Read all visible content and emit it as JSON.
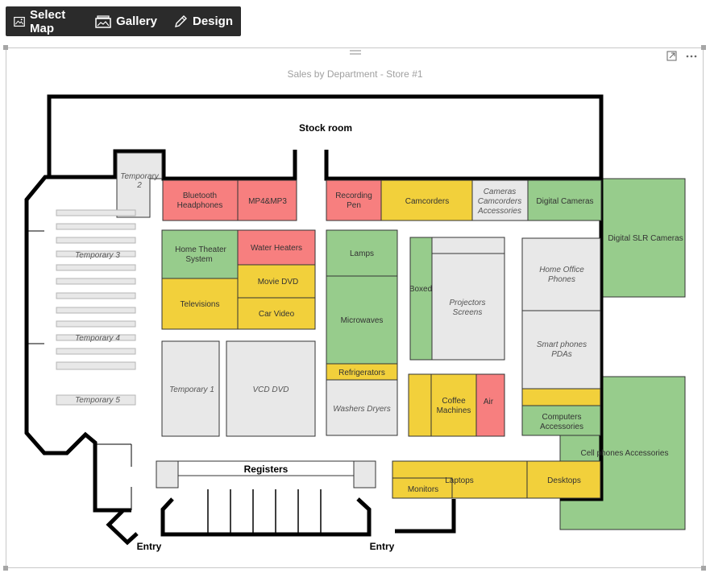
{
  "toolbar": {
    "select_map": "Select Map",
    "gallery": "Gallery",
    "design": "Design"
  },
  "visual": {
    "title": "Sales by Department - Store #1"
  },
  "colors": {
    "red": "#f77f7f",
    "yellow": "#f2d03b",
    "green": "#97cc8c",
    "gray": "#e8e8e8",
    "wall": "#000000"
  },
  "areas": [
    {
      "id": "stock-room",
      "label": "Stock room"
    },
    {
      "id": "temporary-2",
      "label": "Temporary 2"
    },
    {
      "id": "bluetooth-headphones",
      "label": "Bluetooth Headphones"
    },
    {
      "id": "mp4-mp3",
      "label": "MP4&MP3"
    },
    {
      "id": "recording-pen",
      "label": "Recording Pen"
    },
    {
      "id": "camcorders",
      "label": "Camcorders"
    },
    {
      "id": "cameras-camcorders-accessories",
      "label": "Cameras Camcorders Accessories"
    },
    {
      "id": "digital-cameras",
      "label": "Digital Cameras"
    },
    {
      "id": "digital-slr-cameras",
      "label": "Digital SLR Cameras"
    },
    {
      "id": "temporary-3",
      "label": "Temporary 3"
    },
    {
      "id": "temporary-4",
      "label": "Temporary 4"
    },
    {
      "id": "temporary-5",
      "label": "Temporary 5"
    },
    {
      "id": "home-theater-system",
      "label": "Home Theater System"
    },
    {
      "id": "water-heaters",
      "label": "Water Heaters"
    },
    {
      "id": "movie-dvd",
      "label": "Movie DVD"
    },
    {
      "id": "televisions",
      "label": "Televisions"
    },
    {
      "id": "car-video",
      "label": "Car Video"
    },
    {
      "id": "lamps",
      "label": "Lamps"
    },
    {
      "id": "microwaves",
      "label": "Microwaves"
    },
    {
      "id": "refrigerators",
      "label": "Refrigerators"
    },
    {
      "id": "washers-dryers",
      "label": "Washers Dryers"
    },
    {
      "id": "boxed",
      "label": "Boxed"
    },
    {
      "id": "projectors-screens",
      "label": "Projectors Screens"
    },
    {
      "id": "coffee-machines",
      "label": "Coffee Machines"
    },
    {
      "id": "air",
      "label": "Air"
    },
    {
      "id": "home-office-phones",
      "label": "Home Office Phones"
    },
    {
      "id": "smart-phones-pdas",
      "label": "Smart phones PDAs"
    },
    {
      "id": "computers-accessories",
      "label": "Computers Accessories"
    },
    {
      "id": "cell-phones-accessories",
      "label": "Cell phones Accessories"
    },
    {
      "id": "temporary-1",
      "label": "Temporary 1"
    },
    {
      "id": "vcd-dvd",
      "label": "VCD DVD"
    },
    {
      "id": "registers",
      "label": "Registers"
    },
    {
      "id": "laptops",
      "label": "Laptops"
    },
    {
      "id": "monitors",
      "label": "Monitors"
    },
    {
      "id": "desktops",
      "label": "Desktops"
    },
    {
      "id": "entry-left",
      "label": "Entry"
    },
    {
      "id": "entry-right",
      "label": "Entry"
    }
  ]
}
